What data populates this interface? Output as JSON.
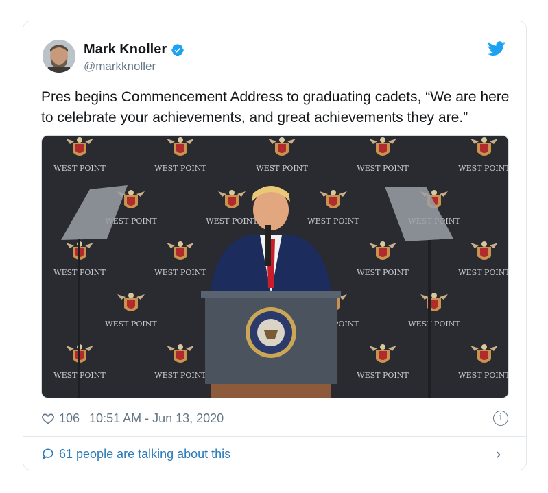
{
  "tweet": {
    "author": {
      "name": "Mark Knoller",
      "handle": "@markknoller",
      "avatar_icon": "avatar",
      "verified_icon": "verified-badge-icon"
    },
    "text": "Pres begins Commencement Address to graduating cadets, “We are here to celebrate your achievements, and great achievements they are.”",
    "media": {
      "backdrop_text": "WEST POINT"
    },
    "likes": "106",
    "timestamp": "10:51 AM - Jun 13, 2020",
    "info_icon": "info-icon",
    "talking": "61 people are talking about this"
  },
  "colors": {
    "brand": "#1da1f2",
    "link": "#2b7bb9",
    "secondary_text": "#657786",
    "border": "#e1e8ed"
  }
}
